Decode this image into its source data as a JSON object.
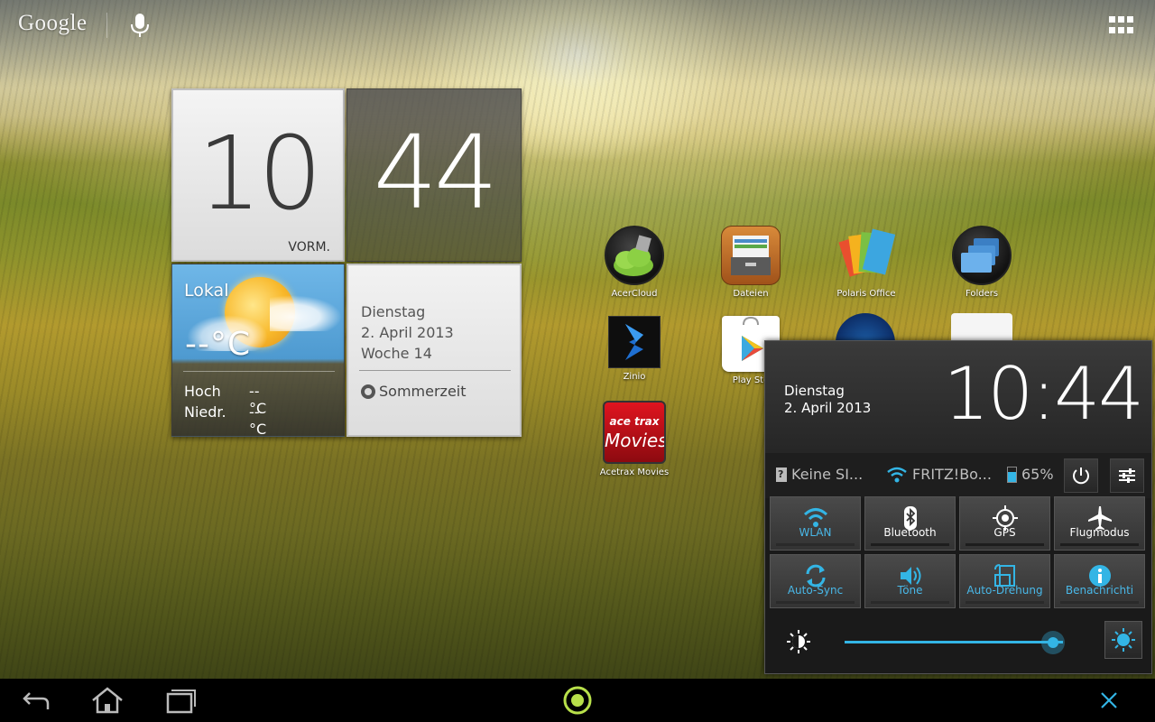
{
  "top_bar": {
    "google_label": "Google",
    "icons": [
      "mic-icon",
      "apps-grid-icon"
    ]
  },
  "clock_widget": {
    "hour": "10",
    "minute": "44",
    "ampm": "VORM.",
    "weather": {
      "location": "Lokal",
      "temp": "--°C",
      "high_label": "Hoch",
      "high_value": "--°C",
      "low_label": "Niedr.",
      "low_value": "--°C"
    },
    "date": {
      "weekday": "Dienstag",
      "date": "2. April 2013",
      "week": "Woche 14",
      "dst": "Sommerzeit"
    }
  },
  "apps": [
    {
      "label": "AcerCloud",
      "icon": "acercloud-icon"
    },
    {
      "label": "Dateien",
      "icon": "files-drawer-icon"
    },
    {
      "label": "Polaris Office",
      "icon": "polaris-office-icon"
    },
    {
      "label": "Folders",
      "icon": "folders-icon"
    },
    {
      "label": "Zinio",
      "icon": "zinio-icon"
    },
    {
      "label": "Play Sto",
      "icon": "play-store-icon"
    },
    {
      "label": "Acetrax Movies",
      "icon": "acetrax-movies-icon",
      "art_text_1": "ace trax",
      "art_text_2": "Movies"
    }
  ],
  "quick_panel": {
    "weekday": "Dienstag",
    "date": "2. April 2013",
    "time": "10:44",
    "status": {
      "sim": "Keine SI...",
      "wifi": "FRITZ!Bo...",
      "battery": "65%"
    },
    "toggles": [
      {
        "label": "WLAN",
        "icon": "wifi-icon",
        "on": true
      },
      {
        "label": "Bluetooth",
        "icon": "bluetooth-icon",
        "on": false
      },
      {
        "label": "GPS",
        "icon": "gps-icon",
        "on": false
      },
      {
        "label": "Flugmodus",
        "icon": "airplane-icon",
        "on": false
      },
      {
        "label": "Auto-Sync",
        "icon": "sync-icon",
        "on": true
      },
      {
        "label": "Töne",
        "icon": "volume-icon",
        "on": true
      },
      {
        "label": "Auto-Drehung",
        "icon": "rotate-icon",
        "on": true
      },
      {
        "label": "Benachrichti",
        "icon": "info-icon",
        "on": true
      }
    ],
    "brightness_level": 0.94
  },
  "colors": {
    "accent_blue": "#33b5e5",
    "panel_bg": "#1a1a1a"
  }
}
